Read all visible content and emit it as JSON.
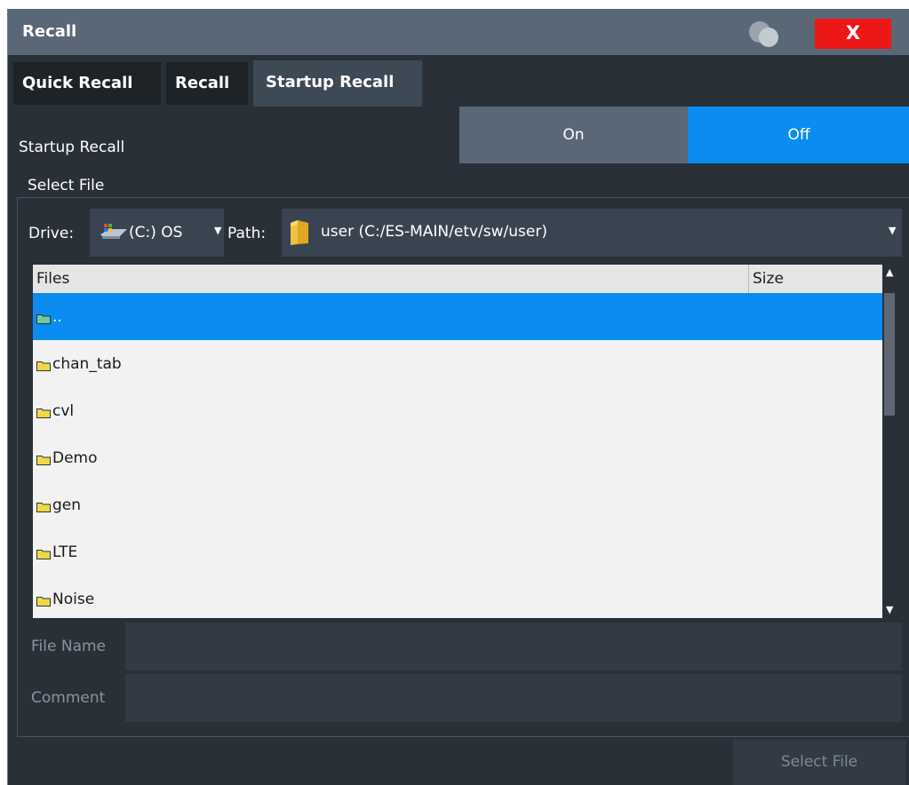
{
  "window": {
    "title": "Recall",
    "close_label": "X"
  },
  "tabs": [
    {
      "label": "Quick Recall",
      "active": false
    },
    {
      "label": "Recall",
      "active": false
    },
    {
      "label": "Startup Recall",
      "active": true
    }
  ],
  "startup_recall": {
    "label": "Startup Recall",
    "on_label": "On",
    "off_label": "Off",
    "selected": "Off"
  },
  "select_file": {
    "group_label": "Select File",
    "drive_label": "Drive:",
    "drive_value": "(C:) OS",
    "path_label": "Path:",
    "path_value": "user (C:/ES-MAIN/etv/sw/user)"
  },
  "file_list": {
    "columns": [
      "Files",
      "Size"
    ],
    "rows": [
      {
        "name": "..",
        "size": "",
        "selected": true
      },
      {
        "name": "chan_tab",
        "size": "",
        "selected": false
      },
      {
        "name": "cvl",
        "size": "",
        "selected": false
      },
      {
        "name": "Demo",
        "size": "",
        "selected": false
      },
      {
        "name": "gen",
        "size": "",
        "selected": false
      },
      {
        "name": "LTE",
        "size": "",
        "selected": false
      },
      {
        "name": "Noise",
        "size": "",
        "selected": false
      }
    ]
  },
  "fields": {
    "file_name_label": "File Name",
    "file_name_value": "",
    "comment_label": "Comment",
    "comment_value": ""
  },
  "actions": {
    "select_file_button": "Select File"
  },
  "colors": {
    "accent": "#0a8cf0",
    "close": "#ee1717",
    "background": "#2a3038",
    "title_bar": "#5a6776"
  },
  "icons": {
    "help": "help-icon",
    "close": "close-icon",
    "drive": "drive-icon",
    "path": "folder-icon",
    "row": "folder-icon",
    "scroll_up": "scroll-up-icon",
    "scroll_down": "scroll-down-icon"
  }
}
